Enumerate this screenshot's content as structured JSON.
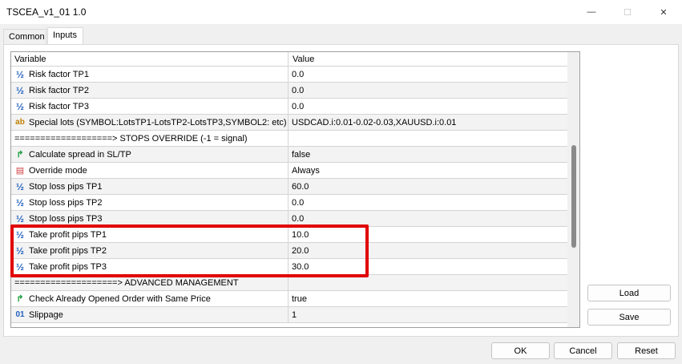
{
  "window": {
    "title": "TSCEA_v1_01 1.0",
    "minimize_glyph": "—",
    "maximize_glyph": "☐",
    "close_glyph": "✕"
  },
  "tabs": [
    {
      "label": "Common"
    },
    {
      "label": "Inputs"
    }
  ],
  "grid": {
    "header": {
      "variable": "Variable",
      "value": "Value"
    },
    "rows": [
      {
        "icon": "fraction-icon",
        "glyph": "½",
        "variable": "Risk factor TP1",
        "value": "0.0"
      },
      {
        "icon": "fraction-icon",
        "glyph": "½",
        "variable": "Risk factor TP2",
        "value": "0.0"
      },
      {
        "icon": "fraction-icon",
        "glyph": "½",
        "variable": "Risk factor TP3",
        "value": "0.0"
      },
      {
        "icon": "text-ab-icon",
        "glyph": "ab",
        "variable": "Special lots (SYMBOL:LotsTP1-LotsTP2-LotsTP3,SYMBOL2: etc)",
        "value": "USDCAD.i:0.01-0.02-0.03,XAUUSD.i:0.01"
      },
      {
        "icon": "",
        "glyph": "",
        "variable": "===================> STOPS OVERRIDE (-1 = signal)",
        "value": ""
      },
      {
        "icon": "bool-arrow-icon",
        "glyph": "↱",
        "variable": "Calculate spread in SL/TP",
        "value": "false"
      },
      {
        "icon": "enum-icon",
        "glyph": "▤",
        "variable": "Override mode",
        "value": "Always"
      },
      {
        "icon": "fraction-icon",
        "glyph": "½",
        "variable": "Stop loss pips TP1",
        "value": "60.0"
      },
      {
        "icon": "fraction-icon",
        "glyph": "½",
        "variable": "Stop loss pips TP2",
        "value": "0.0"
      },
      {
        "icon": "fraction-icon",
        "glyph": "½",
        "variable": "Stop loss pips TP3",
        "value": "0.0"
      },
      {
        "icon": "fraction-icon",
        "glyph": "½",
        "variable": "Take profit pips TP1",
        "value": "10.0"
      },
      {
        "icon": "fraction-icon",
        "glyph": "½",
        "variable": "Take profit pips TP2",
        "value": "20.0"
      },
      {
        "icon": "fraction-icon",
        "glyph": "½",
        "variable": "Take profit pips TP3",
        "value": "30.0"
      },
      {
        "icon": "",
        "glyph": "",
        "variable": "====================> ADVANCED MANAGEMENT",
        "value": ""
      },
      {
        "icon": "bool-arrow-icon",
        "glyph": "↱",
        "variable": "Check Already Opened Order with Same Price",
        "value": "true"
      },
      {
        "icon": "integer-icon",
        "glyph": "01",
        "variable": "Slippage",
        "value": "1"
      }
    ]
  },
  "buttons": {
    "load": "Load",
    "save": "Save",
    "ok": "OK",
    "cancel": "Cancel",
    "reset": "Reset"
  },
  "colors": {
    "highlight_border": "#e00000"
  }
}
